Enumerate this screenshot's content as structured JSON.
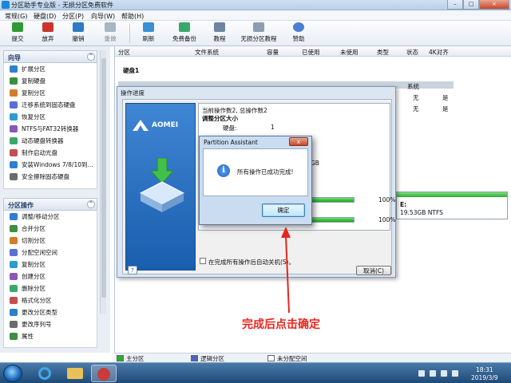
{
  "app": {
    "title": "分区助手专业版 - 无损分区免费软件"
  },
  "menu": [
    "常规(G)",
    "硬盘(D)",
    "分区(P)",
    "向导(W)",
    "帮助(H)"
  ],
  "toolbar": {
    "commit": "提交",
    "discard": "放弃",
    "undo": "撤销",
    "redo": "重做",
    "refresh": "刷新",
    "backup": "免费备份",
    "tutorial": "教程",
    "lossless": "无损分区教程",
    "donate": "赞助"
  },
  "wizard_panel": {
    "title": "向导",
    "items": [
      "扩展分区",
      "复制硬盘",
      "复制分区",
      "迁移系统到固态硬盘",
      "恢复分区",
      "NTFS与FAT32转换器",
      "动态硬盘转换器",
      "制作启动光盘",
      "安装Windows 7/8/10到...",
      "安全擦除固态硬盘"
    ]
  },
  "partition_panel": {
    "title": "分区操作",
    "items": [
      "调整/移动分区",
      "合并分区",
      "切割分区",
      "分配空闲空间",
      "复制分区",
      "创建分区",
      "删除分区",
      "格式化分区",
      "更改分区类型",
      "更改序列号",
      "属性"
    ]
  },
  "columns": [
    "分区",
    "文件系统",
    "容量",
    "已使用",
    "未使用",
    "类型",
    "状态",
    "4K对齐"
  ],
  "disk_label": "硬盘1",
  "system_label": "系统",
  "status_rows": [
    [
      "无",
      "是"
    ],
    [
      "无",
      "是"
    ]
  ],
  "disk_bar": {
    "drive": "E:",
    "info": "19.53GB NTFS"
  },
  "legend": {
    "primary": "主分区",
    "logical": "逻辑分区",
    "unallocated": "未分配空间"
  },
  "progress_dialog": {
    "title": "操作进度",
    "brand": "AOMEI",
    "op_count": "当前操作数2, 总操作数2",
    "op_title": "调整分区大小",
    "disk_label": "硬盘:",
    "disk_value": "1",
    "size_fragment": "GB",
    "progress1": "100%",
    "progress2": "100%",
    "progress1_value": 100,
    "progress2_value": 100,
    "shutdown_label": "在完成所有操作后自动关机(S)。",
    "help": "?",
    "cancel": "取消(C)"
  },
  "alert": {
    "title": "Partition Assistant",
    "close": "x",
    "info_glyph": "i",
    "message": "所有操作已成功完成!",
    "ok": "确定"
  },
  "annotation": "完成后点击确定",
  "taskbar": {
    "time": "18:31",
    "date": "2019/3/9"
  },
  "colors": {
    "accent": "#1a5eae",
    "annotation": "#e8241f",
    "progress": "#1ea21e"
  }
}
